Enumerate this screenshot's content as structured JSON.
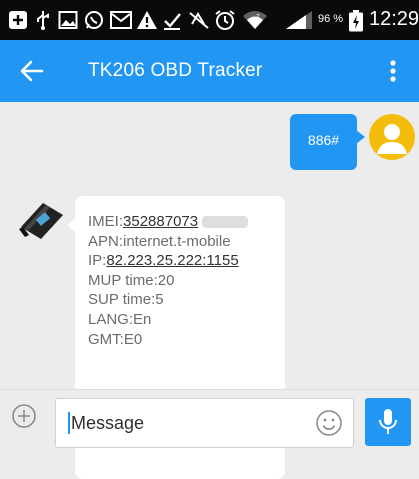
{
  "status_bar": {
    "icons": [
      "plus-square-icon",
      "usb-icon",
      "image-icon",
      "whatsapp-icon",
      "gmail-icon",
      "warning-icon",
      "download-icon",
      "mute-icon",
      "alarm-icon",
      "wifi-icon",
      "signal-icon"
    ],
    "battery_pct": "96 %",
    "time": "12:29"
  },
  "app_bar": {
    "title": "TK206 OBD Tracker",
    "color": "#2196f3"
  },
  "messages": {
    "outgoing": {
      "text": "886#"
    },
    "incoming": {
      "imei_label": "IMEI:",
      "imei_value": "352887073",
      "apn": "APN:internet.t-mobile",
      "ip_label": "IP:",
      "ip_value": "82.223.25.222:1155",
      "mup": "MUP time:20",
      "sup": "SUP time:5",
      "lang": "LANG:En",
      "gmt": "GMT:E0"
    }
  },
  "composer": {
    "placeholder": "Message"
  },
  "colors": {
    "accent": "#2196f3",
    "avatar": "#f5bd0b",
    "background": "#ececec"
  }
}
